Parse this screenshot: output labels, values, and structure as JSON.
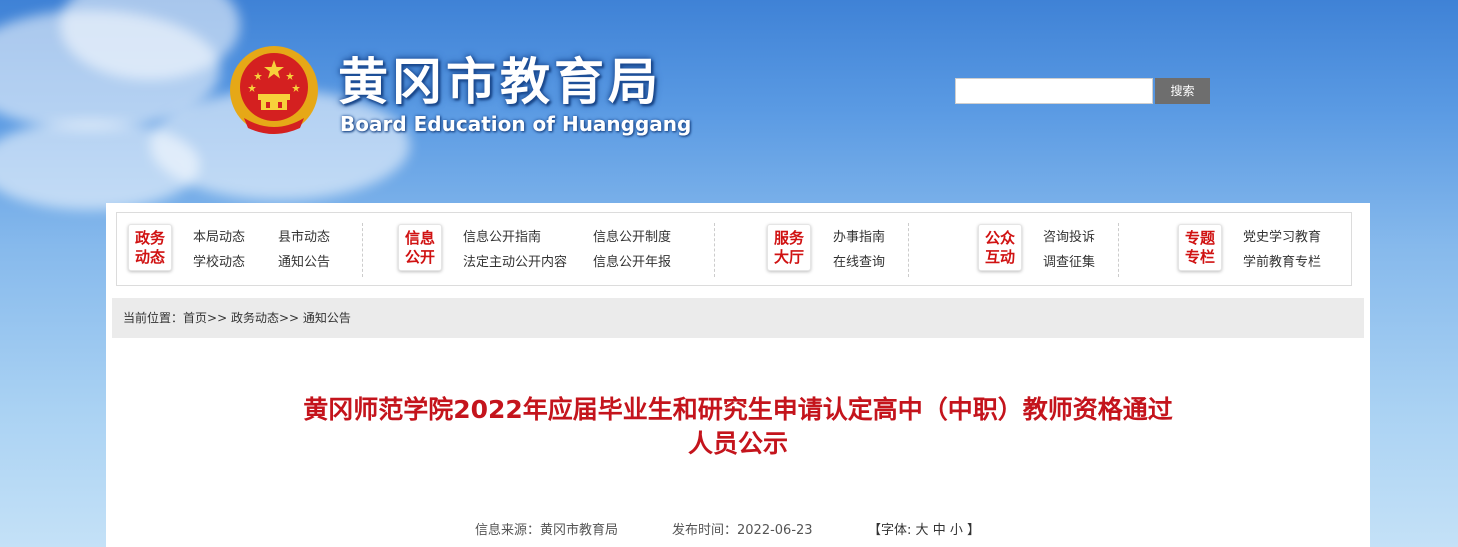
{
  "header": {
    "site_title": "黄冈市教育局",
    "site_subtitle": "Board Education of Huanggang",
    "emblem_icon": "national-emblem-icon"
  },
  "search": {
    "placeholder": "",
    "button_label": "搜索"
  },
  "nav": {
    "groups": [
      {
        "badge": [
          "政务",
          "动态"
        ],
        "links": [
          "本局动态",
          "县市动态",
          "学校动态",
          "通知公告"
        ]
      },
      {
        "badge": [
          "信息",
          "公开"
        ],
        "links": [
          "信息公开指南",
          "信息公开制度",
          "法定主动公开内容",
          "信息公开年报"
        ]
      },
      {
        "badge": [
          "服务",
          "大厅"
        ],
        "links": [
          "办事指南",
          "在线查询"
        ]
      },
      {
        "badge": [
          "公众",
          "互动"
        ],
        "links": [
          "咨询投诉",
          "调查征集"
        ]
      },
      {
        "badge": [
          "专题",
          "专栏"
        ],
        "links": [
          "党史学习教育",
          "学前教育专栏"
        ]
      }
    ]
  },
  "breadcrumb": {
    "prefix": "当前位置：",
    "items": [
      "首页",
      "政务动态",
      "通知公告"
    ],
    "separator": ">>"
  },
  "article": {
    "title_line1": "黄冈师范学院2022年应届毕业生和研究生申请认定高中（中职）教师资格通过",
    "title_line2": "人员公示",
    "source_label": "信息来源：",
    "source": "黄冈市教育局",
    "date_label": "发布时间：",
    "date": "2022-06-23",
    "font_label": "【字体:",
    "font_sizes": [
      "大",
      "中",
      "小"
    ],
    "font_close": "】"
  },
  "colors": {
    "accent_red": "#c4141c",
    "sky_blue": "#5a9ae3",
    "search_button": "#6e6e6e"
  }
}
